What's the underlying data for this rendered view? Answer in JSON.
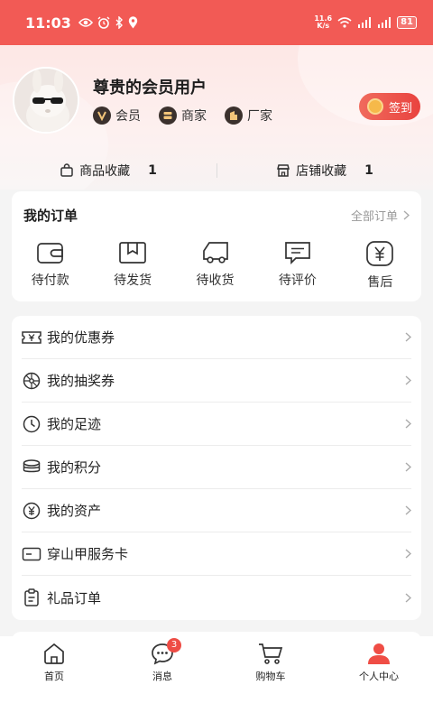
{
  "status_bar": {
    "time": "11:03",
    "net_speed_value": "11.6",
    "net_speed_unit": "K/s",
    "battery": "81"
  },
  "profile": {
    "username": "尊贵的会员用户",
    "badges": [
      {
        "label": "会员",
        "icon": "v-icon"
      },
      {
        "label": "商家",
        "icon": "store-icon"
      },
      {
        "label": "厂家",
        "icon": "factory-icon"
      }
    ],
    "signin_label": "签到"
  },
  "favorites": {
    "goods_label": "商品收藏",
    "goods_count": "1",
    "shop_label": "店铺收藏",
    "shop_count": "1"
  },
  "orders": {
    "title": "我的订单",
    "all_label": "全部订单",
    "items": [
      {
        "label": "待付款",
        "icon": "wallet-icon"
      },
      {
        "label": "待发货",
        "icon": "box-icon"
      },
      {
        "label": "待收货",
        "icon": "truck-icon"
      },
      {
        "label": "待评价",
        "icon": "comment-icon"
      },
      {
        "label": "售后",
        "icon": "yen-icon"
      }
    ]
  },
  "menu": [
    {
      "label": "我的优惠券",
      "icon": "coupon-icon"
    },
    {
      "label": "我的抽奖券",
      "icon": "lottery-icon"
    },
    {
      "label": "我的足迹",
      "icon": "clock-icon"
    },
    {
      "label": "我的积分",
      "icon": "coins-icon"
    },
    {
      "label": "我的资产",
      "icon": "yen-circle-icon"
    },
    {
      "label": "穿山甲服务卡",
      "icon": "card-icon"
    },
    {
      "label": "礼品订单",
      "icon": "clipboard-icon"
    }
  ],
  "tabbar": {
    "tabs": [
      {
        "label": "首页",
        "icon": "home-icon"
      },
      {
        "label": "消息",
        "icon": "message-icon",
        "badge": "3"
      },
      {
        "label": "购物车",
        "icon": "cart-icon"
      },
      {
        "label": "个人中心",
        "icon": "person-icon"
      }
    ]
  },
  "colors": {
    "accent": "#f25a55",
    "badge_red": "#ee4c45"
  }
}
